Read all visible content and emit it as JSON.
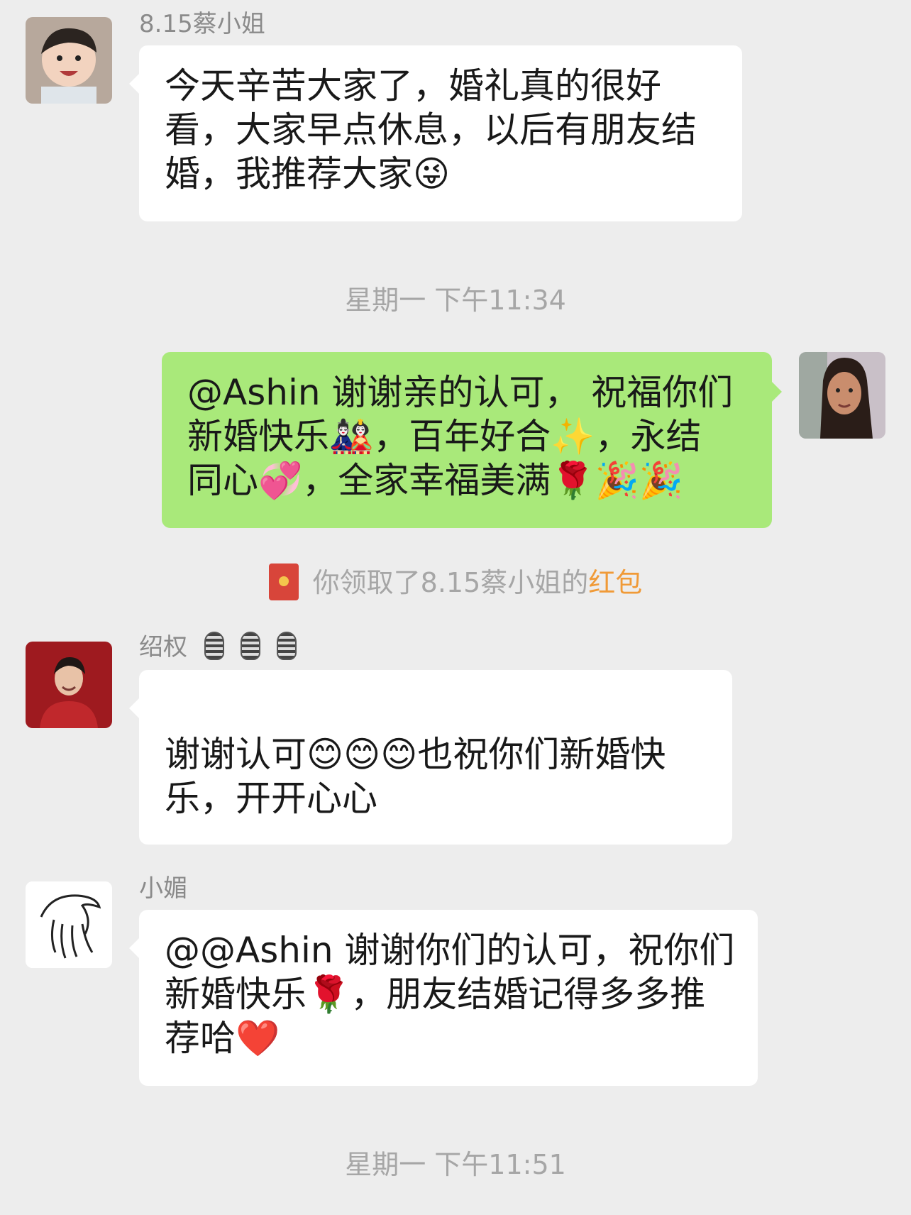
{
  "messages": [
    {
      "sender": "8.15蔡小姐",
      "lines": [
        "今天辛苦大家了，婚礼真的很好",
        "看，大家早点休息，以后有朋友结",
        "婚，我推荐大家😜"
      ]
    },
    {
      "timestamp": "星期一 下午11:34"
    },
    {
      "lines": [
        "@Ashin 谢谢亲的认可，  祝福你们",
        "新婚快乐🎎，百年好合✨，永结",
        "同心💞，全家幸福美满🌹🎉🎉"
      ]
    },
    {
      "system_prefix": "你领取了8.15蔡小姐的",
      "system_link": "红包"
    },
    {
      "sender": "绍权",
      "lines": [
        "",
        "谢谢认可😊😊😊也祝你们新婚快",
        "乐，开开心心"
      ]
    },
    {
      "sender": "小媚",
      "lines": [
        "@@Ashin 谢谢你们的认可，祝你们",
        "新婚快乐🌹，朋友结婚记得多多推",
        "荐哈❤️"
      ]
    },
    {
      "timestamp": "星期一 下午11:51"
    }
  ],
  "colors": {
    "background": "#ededed",
    "bubble_in": "#ffffff",
    "bubble_out": "#a9e97a",
    "link": "#f09a37"
  },
  "icons": [
    "avatar-baby",
    "avatar-woman",
    "red-packet-icon",
    "microphone-icon",
    "avatar-man-red",
    "avatar-sketch"
  ]
}
